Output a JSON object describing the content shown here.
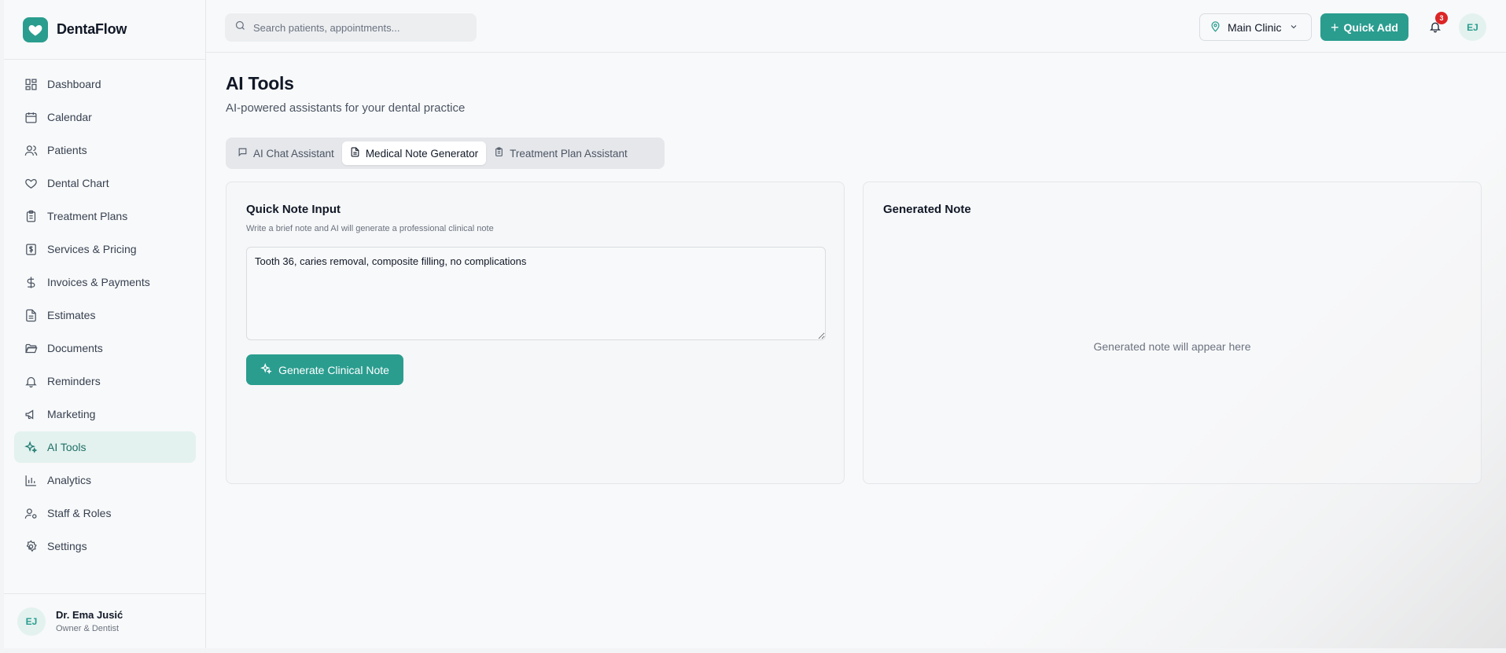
{
  "brand": {
    "name": "DentaFlow"
  },
  "sidebar": {
    "items": [
      {
        "label": "Dashboard",
        "icon": "dashboard-icon",
        "active": false
      },
      {
        "label": "Calendar",
        "icon": "calendar-icon",
        "active": false
      },
      {
        "label": "Patients",
        "icon": "users-icon",
        "active": false
      },
      {
        "label": "Dental Chart",
        "icon": "heart-icon",
        "active": false
      },
      {
        "label": "Treatment Plans",
        "icon": "clipboard-icon",
        "active": false
      },
      {
        "label": "Services & Pricing",
        "icon": "receipt-icon",
        "active": false
      },
      {
        "label": "Invoices & Payments",
        "icon": "dollar-icon",
        "active": false
      },
      {
        "label": "Estimates",
        "icon": "file-text-icon",
        "active": false
      },
      {
        "label": "Documents",
        "icon": "folder-icon",
        "active": false
      },
      {
        "label": "Reminders",
        "icon": "bell-icon",
        "active": false
      },
      {
        "label": "Marketing",
        "icon": "megaphone-icon",
        "active": false
      },
      {
        "label": "AI Tools",
        "icon": "sparkles-icon",
        "active": true
      },
      {
        "label": "Analytics",
        "icon": "bar-chart-icon",
        "active": false
      },
      {
        "label": "Staff & Roles",
        "icon": "user-cog-icon",
        "active": false
      },
      {
        "label": "Settings",
        "icon": "gear-icon",
        "active": false
      }
    ],
    "user": {
      "initials": "EJ",
      "name": "Dr. Ema Jusić",
      "role": "Owner & Dentist"
    }
  },
  "header": {
    "search_placeholder": "Search patients, appointments...",
    "clinic": "Main Clinic",
    "quick_add": "Quick Add",
    "notification_count": "3",
    "avatar_initials": "EJ"
  },
  "main": {
    "title": "AI Tools",
    "subtitle": "AI-powered assistants for your dental practice",
    "tabs": [
      {
        "label": "AI Chat Assistant",
        "icon": "message-icon",
        "active": false
      },
      {
        "label": "Medical Note Generator",
        "icon": "file-icon",
        "active": true
      },
      {
        "label": "Treatment Plan Assistant",
        "icon": "clipboard-icon",
        "active": false
      }
    ],
    "input_card": {
      "title": "Quick Note Input",
      "description": "Write a brief note and AI will generate a professional clinical note",
      "note_value": "Tooth 36, caries removal, composite filling, no complications",
      "button": "Generate Clinical Note"
    },
    "output_card": {
      "title": "Generated Note",
      "placeholder": "Generated note will appear here"
    }
  },
  "colors": {
    "accent": "#2a9d8f",
    "accent_light": "#e3f2ef",
    "badge": "#dc2626"
  }
}
